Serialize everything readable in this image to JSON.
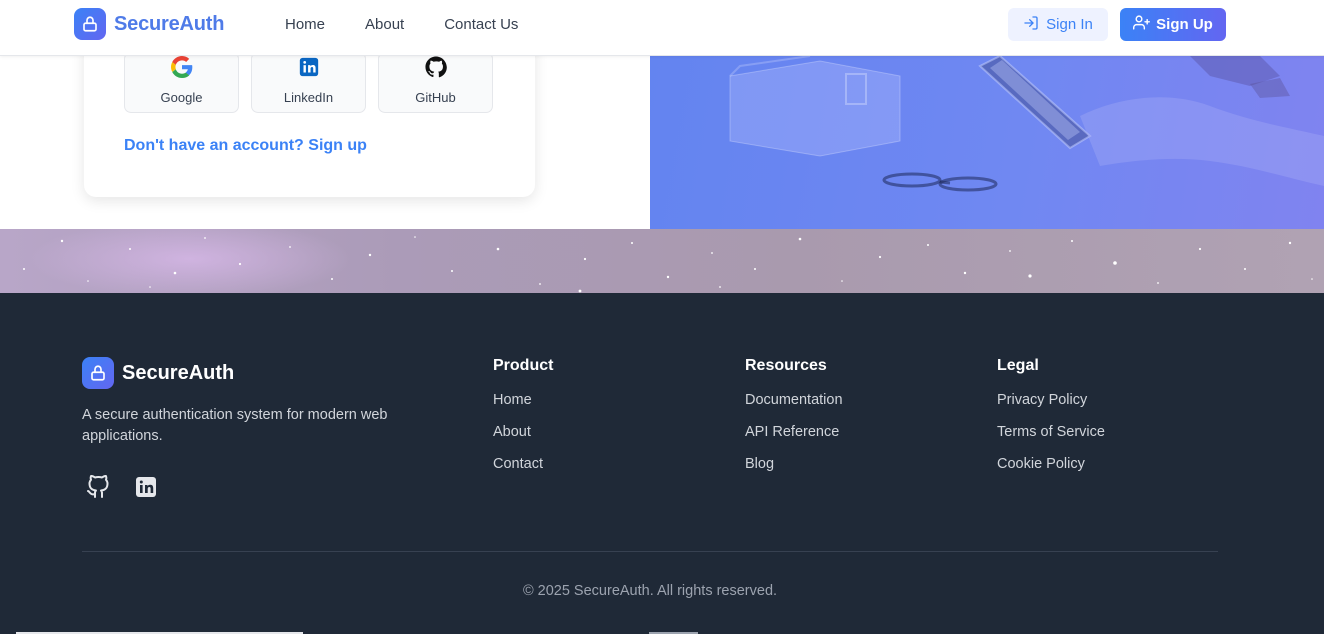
{
  "header": {
    "brand": "SecureAuth",
    "nav": [
      "Home",
      "About",
      "Contact Us"
    ],
    "sign_in": "Sign In",
    "sign_up": "Sign Up"
  },
  "login_card": {
    "social_buttons": [
      "Google",
      "LinkedIn",
      "GitHub"
    ],
    "signup_prompt": "Don't have an account? Sign up"
  },
  "footer": {
    "brand": "SecureAuth",
    "description": "A secure authentication system for modern web applications.",
    "columns": [
      {
        "title": "Product",
        "links": [
          "Home",
          "About",
          "Contact"
        ]
      },
      {
        "title": "Resources",
        "links": [
          "Documentation",
          "API Reference",
          "Blog"
        ]
      },
      {
        "title": "Legal",
        "links": [
          "Privacy Policy",
          "Terms of Service",
          "Cookie Policy"
        ]
      }
    ],
    "copyright": "© 2025 SecureAuth. All rights reserved."
  },
  "colors": {
    "accent": "#3b82f6",
    "accent_gradient_end": "#6366f1",
    "footer_bg": "#1f2937"
  },
  "icons": [
    "lock-icon",
    "sign-in-icon",
    "user-plus-icon",
    "google-icon",
    "linkedin-icon",
    "github-icon"
  ]
}
